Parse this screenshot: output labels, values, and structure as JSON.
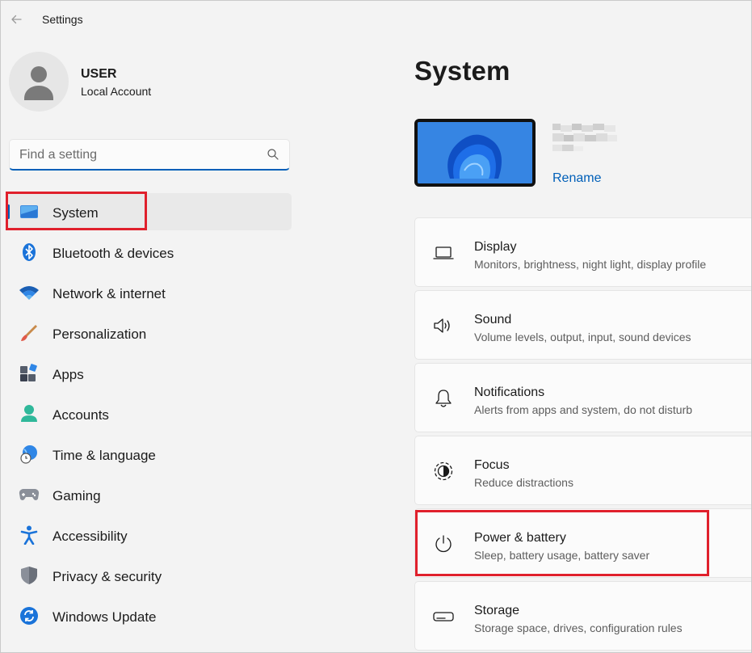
{
  "window": {
    "title": "Settings"
  },
  "user": {
    "name": "USER",
    "account_type": "Local Account"
  },
  "search": {
    "placeholder": "Find a setting"
  },
  "sidebar": {
    "items": [
      {
        "label": "System",
        "icon": "system-icon",
        "active": true
      },
      {
        "label": "Bluetooth & devices",
        "icon": "bluetooth-icon"
      },
      {
        "label": "Network & internet",
        "icon": "wifi-icon"
      },
      {
        "label": "Personalization",
        "icon": "brush-icon"
      },
      {
        "label": "Apps",
        "icon": "apps-icon"
      },
      {
        "label": "Accounts",
        "icon": "accounts-icon"
      },
      {
        "label": "Time & language",
        "icon": "globe-clock-icon"
      },
      {
        "label": "Gaming",
        "icon": "gamepad-icon"
      },
      {
        "label": "Accessibility",
        "icon": "accessibility-icon"
      },
      {
        "label": "Privacy & security",
        "icon": "shield-icon"
      },
      {
        "label": "Windows Update",
        "icon": "update-icon"
      }
    ]
  },
  "main": {
    "title": "System",
    "device": {
      "rename_label": "Rename"
    },
    "cards": [
      {
        "title": "Display",
        "subtitle": "Monitors, brightness, night light, display profile",
        "icon": "display-icon"
      },
      {
        "title": "Sound",
        "subtitle": "Volume levels, output, input, sound devices",
        "icon": "speaker-icon"
      },
      {
        "title": "Notifications",
        "subtitle": "Alerts from apps and system, do not disturb",
        "icon": "bell-icon"
      },
      {
        "title": "Focus",
        "subtitle": "Reduce distractions",
        "icon": "focus-icon"
      },
      {
        "title": "Power & battery",
        "subtitle": "Sleep, battery usage, battery saver",
        "icon": "power-icon"
      },
      {
        "title": "Storage",
        "subtitle": "Storage space, drives, configuration rules",
        "icon": "storage-icon"
      }
    ]
  },
  "colors": {
    "accent": "#005fb8",
    "highlight": "#e0202c",
    "background": "#f3f3f3"
  }
}
